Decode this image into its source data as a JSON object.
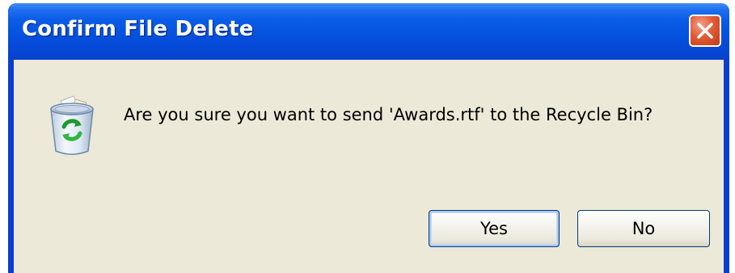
{
  "dialog": {
    "title": "Confirm File Delete",
    "message": "Are you sure you want to send 'Awards.rtf' to the Recycle Bin?",
    "icon": "recycle-bin-icon",
    "buttons": {
      "yes_label": "Yes",
      "no_label": "No",
      "default": "yes"
    },
    "close_icon": "close-icon"
  },
  "colors": {
    "titlebar": "#0552de",
    "client_background": "#ece9d8",
    "close_button": "#e05c36",
    "button_border": "#003c74"
  }
}
